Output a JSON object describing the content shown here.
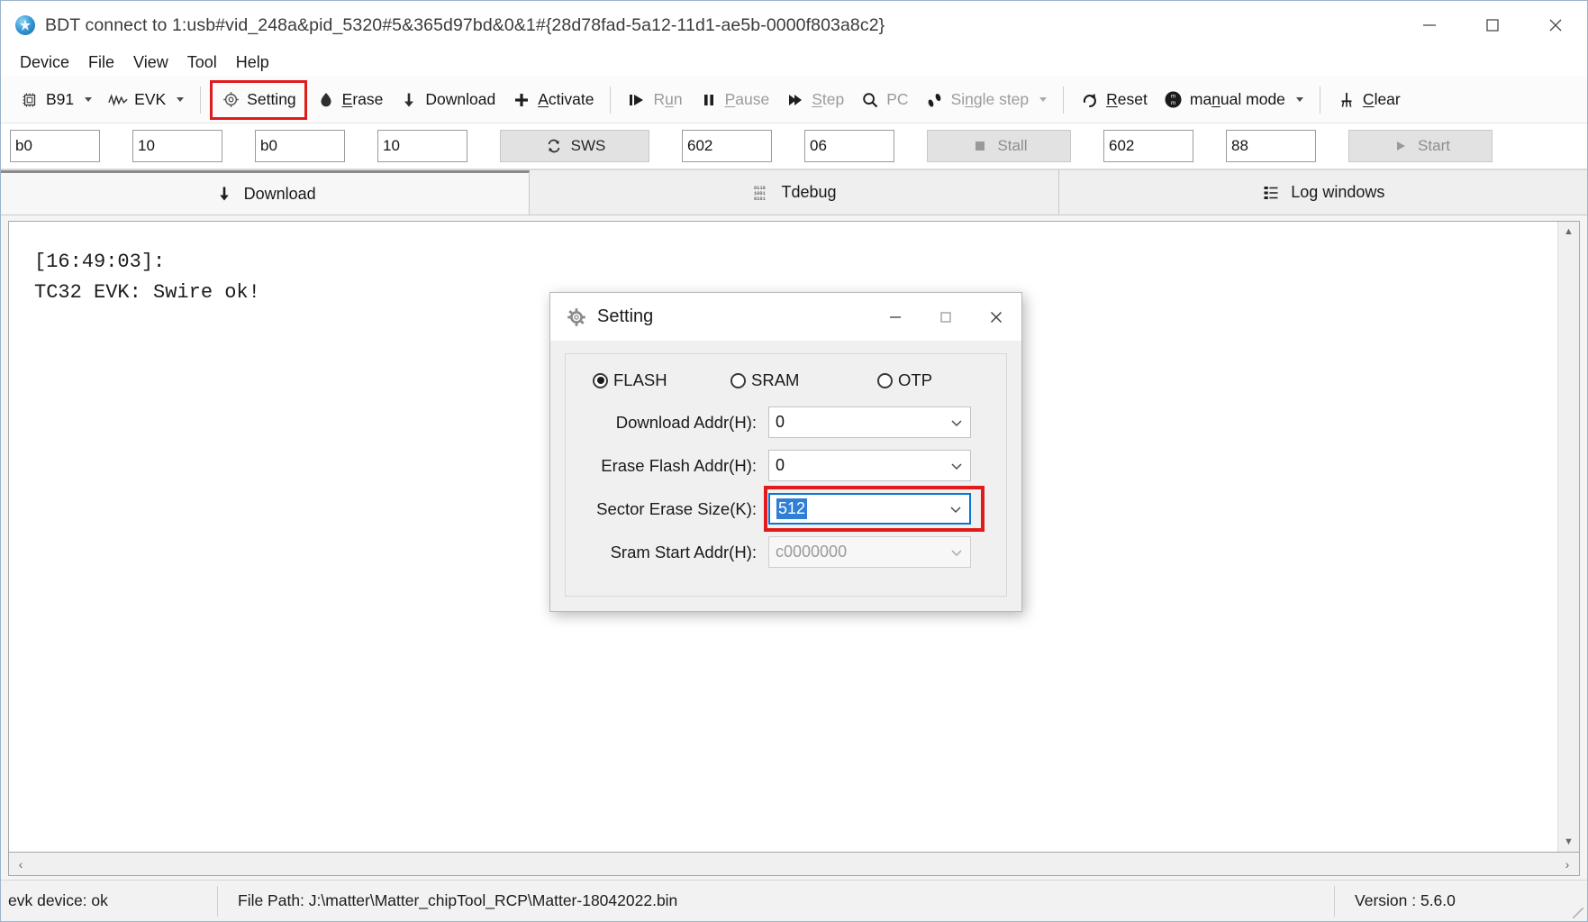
{
  "window": {
    "title": "BDT connect to 1:usb#vid_248a&pid_5320#5&365d97bd&0&1#{28d78fad-5a12-11d1-ae5b-0000f803a8c2}",
    "minimize_label": "Minimize",
    "maximize_label": "Maximize",
    "close_label": "Close"
  },
  "menu": {
    "items": [
      {
        "label": "Device"
      },
      {
        "label": "File"
      },
      {
        "label": "View"
      },
      {
        "label": "Tool"
      },
      {
        "label": "Help"
      }
    ]
  },
  "toolbar": {
    "chip": {
      "label": "B91",
      "icon": "chip-icon",
      "has_caret": true
    },
    "probe": {
      "label": "EVK",
      "icon": "waveform-icon",
      "has_caret": true
    },
    "setting": {
      "label": "Setting",
      "icon": "gear-icon",
      "highlighted": true
    },
    "erase": {
      "label": "Erase",
      "icon": "eraser-icon"
    },
    "download": {
      "label": "Download",
      "icon": "download-arrow-icon"
    },
    "activate": {
      "label": "Activate",
      "icon": "plus-icon"
    },
    "run": {
      "label": "Run",
      "icon": "play-icon",
      "disabled": true
    },
    "pause": {
      "label": "Pause",
      "icon": "pause-icon",
      "disabled": true
    },
    "step": {
      "label": "Step",
      "icon": "step-forward-icon",
      "disabled": true
    },
    "pc": {
      "label": "PC",
      "icon": "magnifier-icon",
      "disabled": true
    },
    "single_step": {
      "label": "Single step",
      "icon": "footsteps-icon",
      "disabled": true,
      "has_caret": true
    },
    "reset": {
      "label": "Reset",
      "icon": "reset-arrow-icon"
    },
    "manual_mode": {
      "label": "manual mode",
      "icon": "mode-circle-icon",
      "has_caret": true
    },
    "clear": {
      "label": "Clear",
      "icon": "broom-icon"
    }
  },
  "fields": {
    "f1": "b0",
    "f2": "10",
    "f3": "b0",
    "f4": "10",
    "sws_label": "SWS",
    "f5": "602",
    "f6": "06",
    "stall_label": "Stall",
    "f7": "602",
    "f8": "88",
    "start_label": "Start"
  },
  "tabs": [
    {
      "label": "Download",
      "icon": "download-arrow-icon",
      "active": true
    },
    {
      "label": "Tdebug",
      "icon": "binary-grid-icon",
      "active": false
    },
    {
      "label": "Log windows",
      "icon": "list-lines-icon",
      "active": false
    }
  ],
  "log": {
    "lines": [
      "[16:49:03]:",
      "TC32 EVK: Swire ok!"
    ],
    "text": "[16:49:03]:\nTC32 EVK: Swire ok!"
  },
  "status": {
    "device": "evk device: ok",
    "file_path": "File Path:  J:\\matter\\Matter_chipTool_RCP\\Matter-18042022.bin",
    "version": "Version : 5.6.0"
  },
  "dialog": {
    "title": "Setting",
    "icon": "gear-icon",
    "minimize_label": "Minimize",
    "maximize_label": "Maximize",
    "close_label": "Close",
    "memory_options": [
      {
        "label": "FLASH",
        "checked": true
      },
      {
        "label": "SRAM",
        "checked": false
      },
      {
        "label": "OTP",
        "checked": false
      }
    ],
    "rows": [
      {
        "label": "Download  Addr(H):",
        "value": "0",
        "disabled": false,
        "focused": false,
        "selected": false
      },
      {
        "label": "Erase Flash Addr(H):",
        "value": "0",
        "disabled": false,
        "focused": false,
        "selected": false
      },
      {
        "label": "Sector Erase Size(K):",
        "value": "512",
        "disabled": false,
        "focused": true,
        "selected": true
      },
      {
        "label": "Sram Start Addr(H):",
        "value": "c0000000",
        "disabled": true,
        "focused": false,
        "selected": false
      }
    ]
  },
  "colors": {
    "highlight_red": "#e01b1b",
    "selection_blue": "#2f7fd6",
    "focus_blue": "#0a74d4",
    "window_bg": "#ffffff",
    "toolbar_bg": "#fbfbfb",
    "dialog_bg": "#f0f0f0"
  }
}
